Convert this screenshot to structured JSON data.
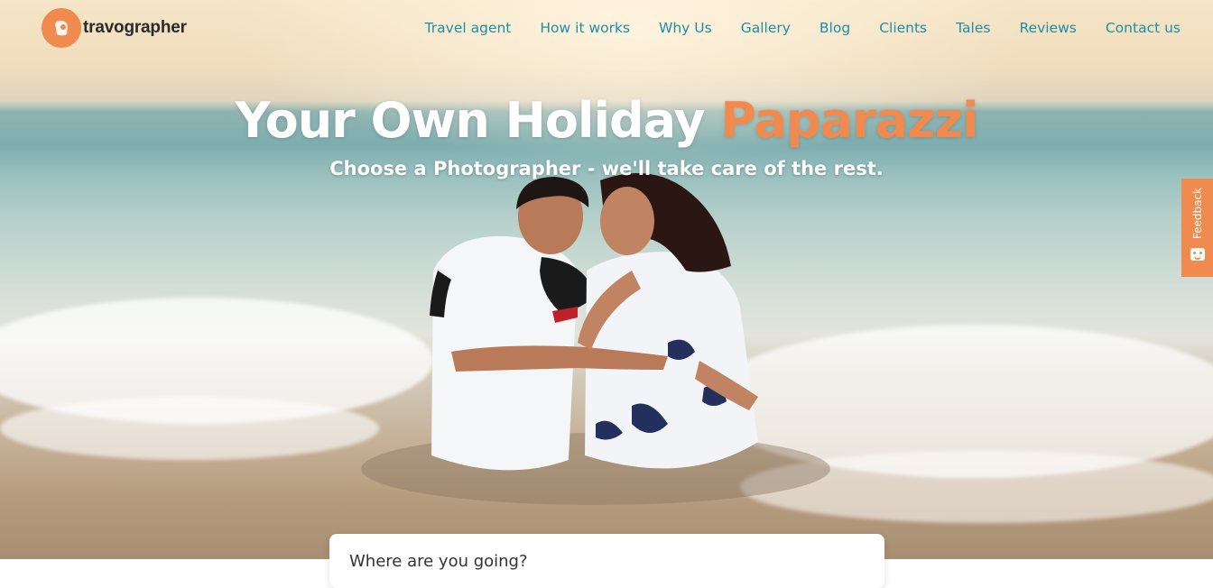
{
  "brand": {
    "name": "travographer",
    "accent_color": "#f08a4f",
    "nav_color": "#1e8fa6"
  },
  "nav": {
    "items": [
      {
        "label": "Travel agent"
      },
      {
        "label": "How it works"
      },
      {
        "label": "Why Us"
      },
      {
        "label": "Gallery"
      },
      {
        "label": "Blog"
      },
      {
        "label": "Clients"
      },
      {
        "label": "Tales"
      },
      {
        "label": "Reviews"
      },
      {
        "label": "Contact us"
      }
    ]
  },
  "hero": {
    "headline_main": "Your Own Holiday",
    "headline_accent": "Paparazzi",
    "subheadline": "Choose a Photographer - we'll take care of the rest.",
    "image_icon": "beach-couple-photo"
  },
  "feedback": {
    "label": "Feedback",
    "icon": "smiley-icon"
  },
  "search_card": {
    "label": "Where are you going?"
  }
}
